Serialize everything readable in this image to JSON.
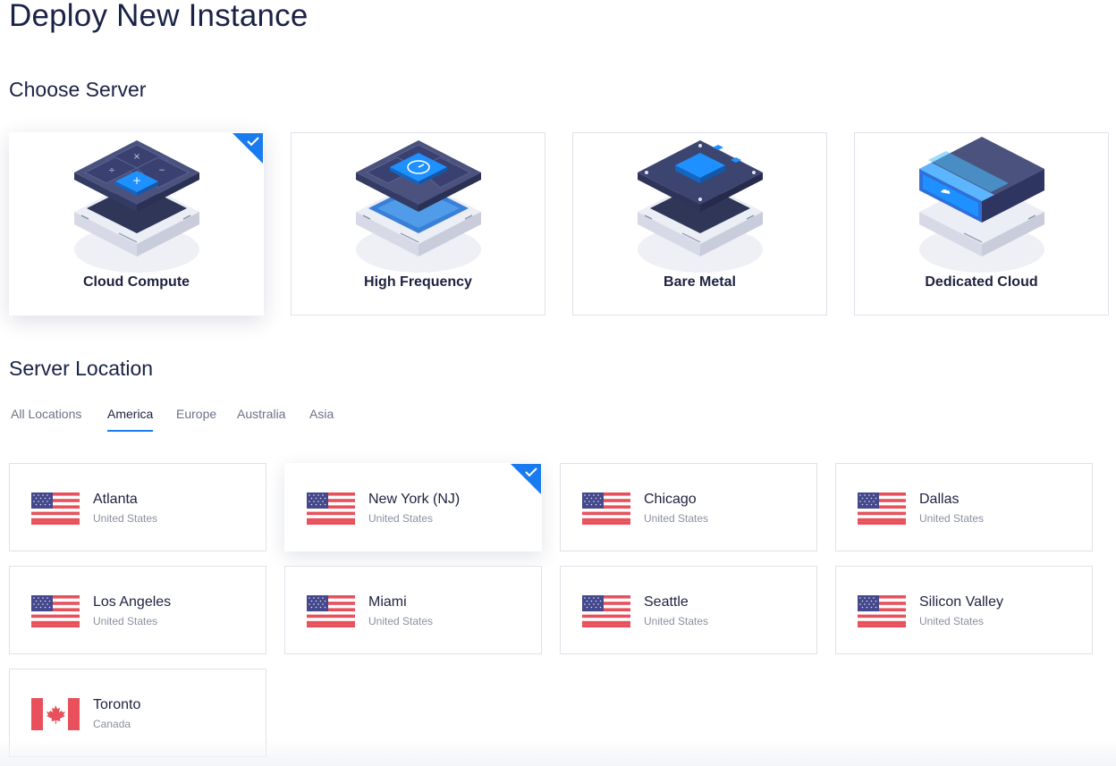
{
  "page": {
    "title": "Deploy New Instance"
  },
  "choose_server": {
    "title": "Choose Server",
    "options": [
      {
        "label": "Cloud Compute",
        "selected": true,
        "icon": "cloud-compute-icon"
      },
      {
        "label": "High Frequency",
        "selected": false,
        "icon": "high-frequency-icon"
      },
      {
        "label": "Bare Metal",
        "selected": false,
        "icon": "bare-metal-icon"
      },
      {
        "label": "Dedicated Cloud",
        "selected": false,
        "icon": "dedicated-cloud-icon"
      }
    ]
  },
  "server_location": {
    "title": "Server Location",
    "tabs": [
      {
        "label": "All Locations",
        "active": false
      },
      {
        "label": "America",
        "active": true
      },
      {
        "label": "Europe",
        "active": false
      },
      {
        "label": "Australia",
        "active": false
      },
      {
        "label": "Asia",
        "active": false
      }
    ],
    "locations": [
      {
        "city": "Atlanta",
        "country": "United States",
        "flag": "us-flag-icon",
        "selected": false
      },
      {
        "city": "New York (NJ)",
        "country": "United States",
        "flag": "us-flag-icon",
        "selected": true
      },
      {
        "city": "Chicago",
        "country": "United States",
        "flag": "us-flag-icon",
        "selected": false
      },
      {
        "city": "Dallas",
        "country": "United States",
        "flag": "us-flag-icon",
        "selected": false
      },
      {
        "city": "Los Angeles",
        "country": "United States",
        "flag": "us-flag-icon",
        "selected": false
      },
      {
        "city": "Miami",
        "country": "United States",
        "flag": "us-flag-icon",
        "selected": false
      },
      {
        "city": "Seattle",
        "country": "United States",
        "flag": "us-flag-icon",
        "selected": false
      },
      {
        "city": "Silicon Valley",
        "country": "United States",
        "flag": "us-flag-icon",
        "selected": false
      },
      {
        "city": "Toronto",
        "country": "Canada",
        "flag": "canada-flag-icon",
        "selected": false
      }
    ]
  },
  "colors": {
    "accent": "#1a7bf0",
    "text_dark": "#1d2240",
    "text_muted": "#8a90a0",
    "border": "#dfe2ea",
    "server_dark": "#3c4470",
    "server_light": "#e6e8f1",
    "flag_red": "#e8505b",
    "flag_blue": "#44488c"
  }
}
